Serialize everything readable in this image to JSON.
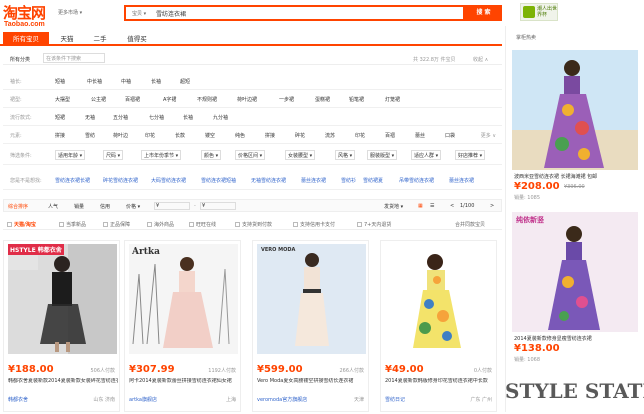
{
  "header": {
    "logo_cn": "淘宝网",
    "logo_en": "Taobao.com",
    "market": "更多市场 ▾",
    "search_category": "宝贝 ▾",
    "search_query": "雪纺连衣裙",
    "search_button": "搜 索",
    "badge_text": "潮人出世界杯"
  },
  "tabs": [
    "所有宝贝",
    "天猫",
    "二手",
    "值得买"
  ],
  "crumbs": {
    "all": "所有分类",
    "search_in": "在该条件下搜索",
    "result_count": "共 322.8万 件宝贝",
    "collapse": "收起 ∧"
  },
  "filters": [
    {
      "label": "袖长:",
      "options": [
        "短袖",
        "中长袖",
        "中袖",
        "长袖",
        "超短"
      ],
      "more": ""
    },
    {
      "label": "裙型:",
      "options": [
        "大摆型",
        "公主裙",
        "百褶裙",
        "A字裙",
        "不规则裙",
        "荷叶边裙",
        "一步裙",
        "蛋糕裙",
        "铅笔裙",
        "灯笼裙"
      ],
      "more": ""
    },
    {
      "label": "流行款式:",
      "options": [
        "短裙",
        "无袖",
        "五分袖",
        "七分袖",
        "长袖",
        "九分袖"
      ],
      "more": ""
    },
    {
      "label": "元素:",
      "options": [
        "拼接",
        "雪纺",
        "荷叶边",
        "印花",
        "长款",
        "镂空",
        "纯色",
        "拼接",
        "碎花",
        "流苏",
        "印花",
        "百褶",
        "蕾丝",
        "口袋"
      ],
      "more": "更多 ∨"
    },
    {
      "label": "筛选条件:",
      "options": [],
      "more": ""
    },
    {
      "label": "您是不是想找:",
      "options": [
        "雪纺连衣裙长裙",
        "碎花雪纺连衣裙",
        "大码雪纺连衣裙",
        "雪纺连衣裙短袖",
        "无袖雪纺连衣裙",
        "蕾丝连衣裙",
        "雪纺衫",
        "雪纺裙夏",
        "吊带雪纺连衣裙",
        "蕾丝连衣裙"
      ],
      "more": ""
    }
  ],
  "dropdowns": [
    "适用年龄 ▾",
    "尺码 ▾",
    "上市年份季节 ▾",
    "颜色 ▾",
    "价格区间 ▾",
    "女装腰型 ▾",
    "风格 ▾",
    "服装版型 ▾",
    "适应人群 ▾",
    "好店推荐 ▾"
  ],
  "sort": {
    "items": [
      "综合排序",
      "人气",
      "销量",
      "信用",
      "价格 ▾"
    ],
    "price_from": "¥",
    "price_to": "¥",
    "location": "发货地 ▾",
    "view_list": "☰",
    "view_grid": "▦",
    "pager": "1/100",
    "prev": "<",
    "next": ">"
  },
  "checks": [
    "天猫/淘宝",
    "当季新品",
    "正品保障",
    "海外商品",
    "旺旺在线",
    "支持货到付款",
    "支持信用卡支付",
    "7+天内退货",
    "合并同款宝贝"
  ],
  "products": [
    {
      "price": "¥188.00",
      "paid": "506人付款",
      "title": "韩都衣舍夏装新款2014夏装新款女装碎花雪纺连衣裙",
      "shop": "韩都衣舍",
      "loc": "山东 济南",
      "tag": "HSTYLE 韩都衣舍"
    },
    {
      "price": "¥307.99",
      "paid": "1192人付款",
      "title": "阿卡2014夏装新款蕾丝拼接雪纺连衣裙仙女裙",
      "shop": "artka旗舰店",
      "loc": "上海",
      "tag": "Artka"
    },
    {
      "price": "¥599.00",
      "paid": "266人付款",
      "title": "Vero Moda夏女高腰镂空拼接雪纺长连衣裙",
      "shop": "veromoda官方旗舰店",
      "loc": "天津",
      "tag": "VERO MODA"
    },
    {
      "price": "¥49.00",
      "paid": "0人付款",
      "title": "2014夏装新款韩版修身印花雪纺连衣裙中长款",
      "shop": "雪纺日记",
      "loc": "广东 广州",
      "tag": ""
    }
  ],
  "sidebar": {
    "heading": "掌柜热卖",
    "items": [
      {
        "title": "波西米亚雪纺连衣裙 长裙海滩裙 包邮",
        "price": "¥208.00",
        "old": "¥396.00",
        "sold": "销量: 1085"
      },
      {
        "title": "2014夏装新款修身显瘦雪纺连衣裙",
        "price": "¥138.00",
        "old": "",
        "sold": "销量: 1068",
        "banner": "纯依新竖"
      }
    ]
  },
  "watermark": "STYLE STATION"
}
